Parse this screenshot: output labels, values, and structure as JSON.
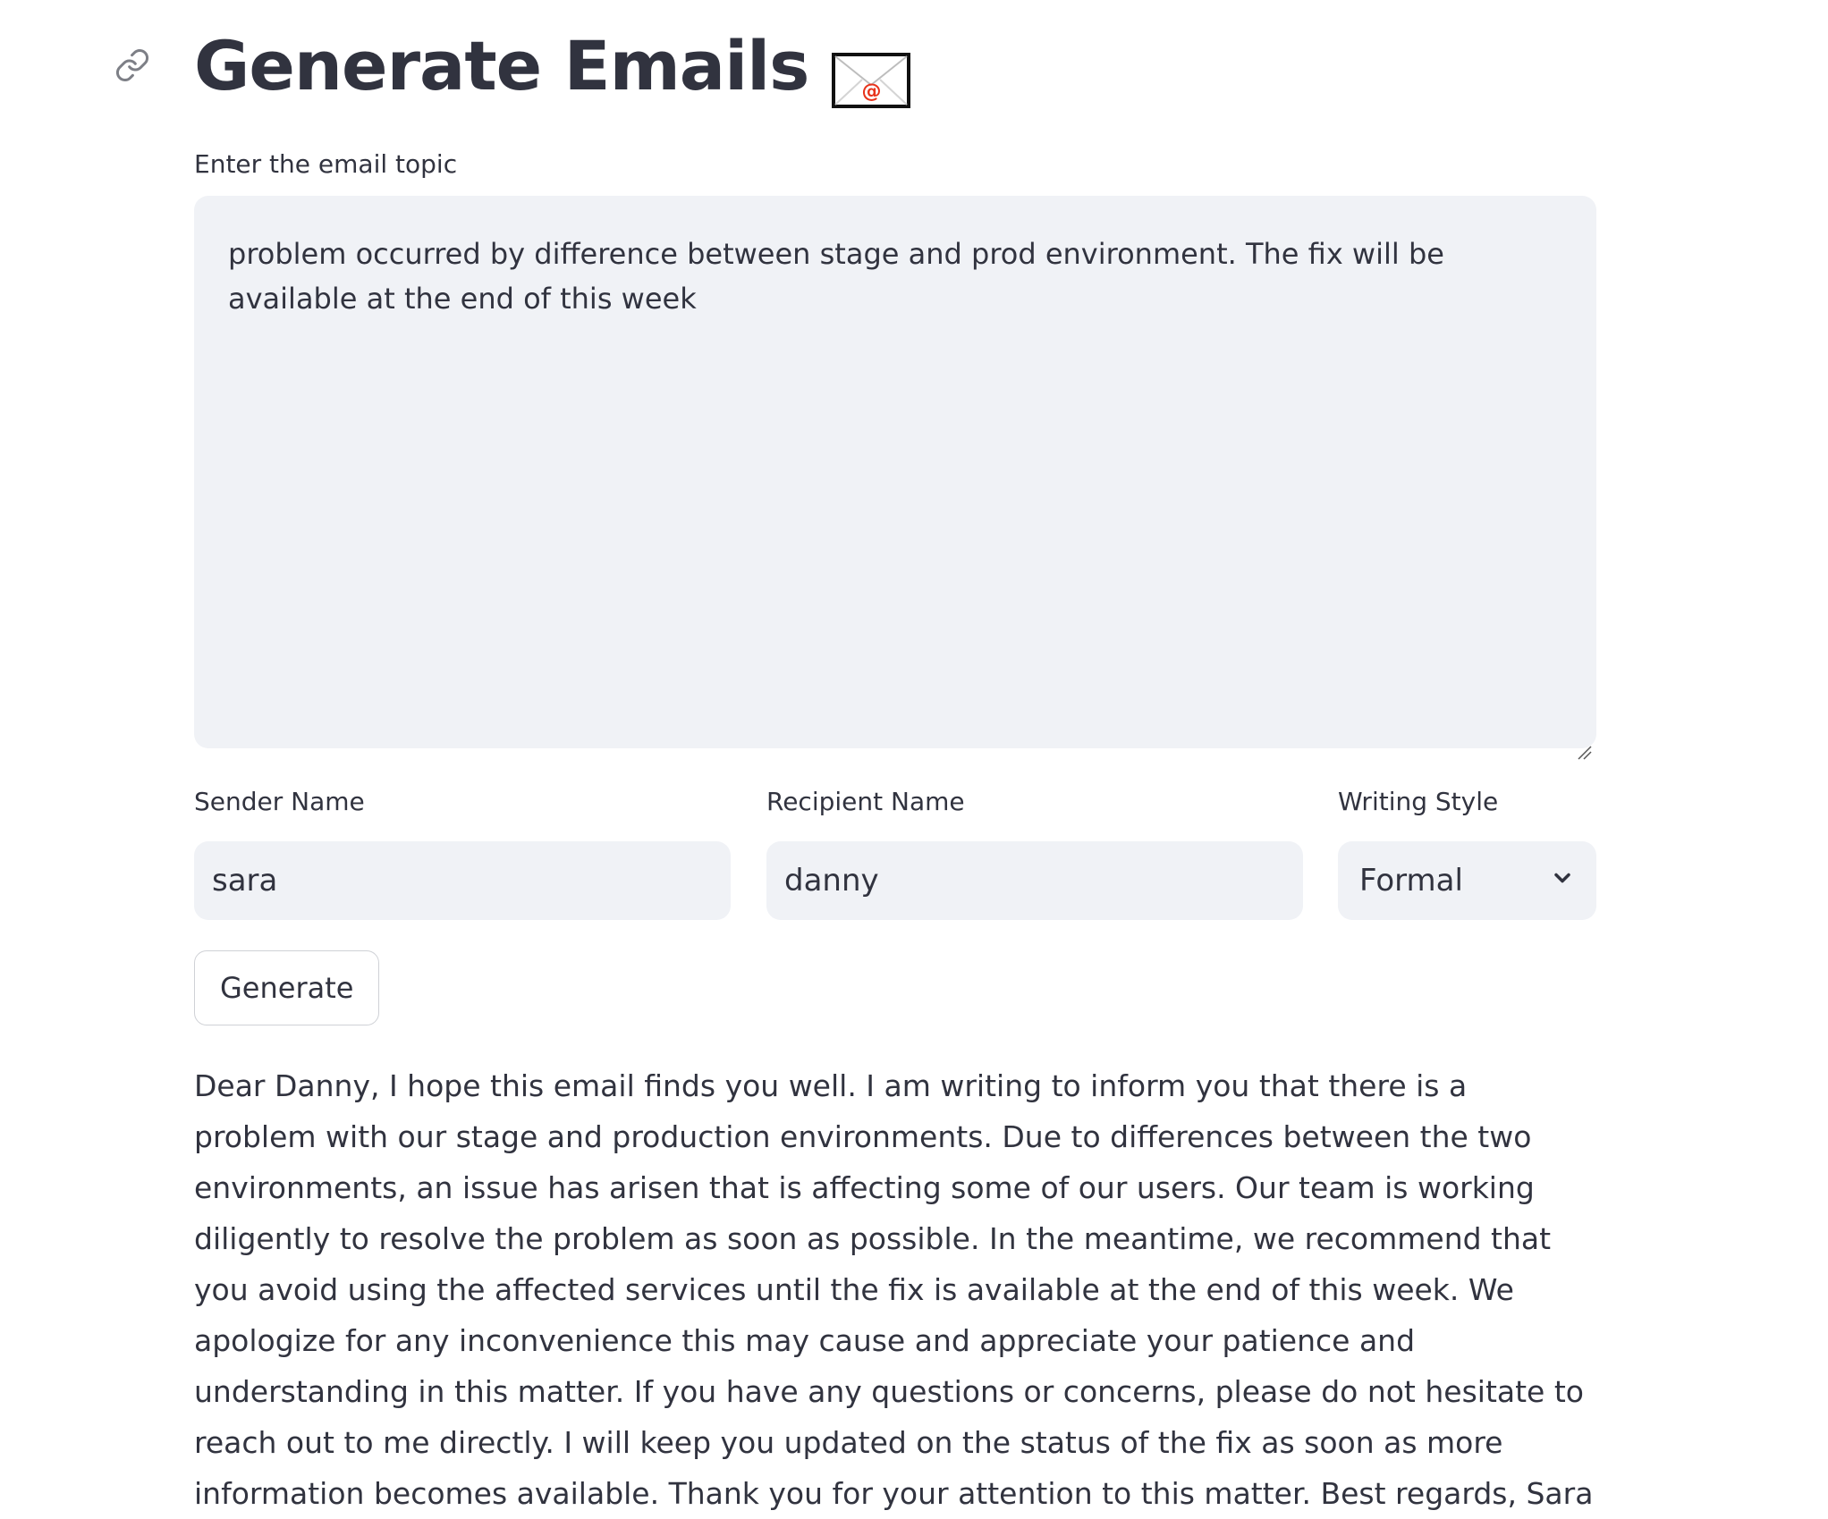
{
  "header": {
    "title": "Generate Emails",
    "title_emoji": "email-emoji",
    "link_icon": "link-icon"
  },
  "topic": {
    "label": "Enter the email topic",
    "value": "problem occurred by difference between stage and prod environment. The fix will be available at the end of this week"
  },
  "sender": {
    "label": "Sender Name",
    "value": "sara"
  },
  "recipient": {
    "label": "Recipient Name",
    "value": "danny"
  },
  "style": {
    "label": "Writing Style",
    "selected": "Formal"
  },
  "actions": {
    "generate_label": "Generate"
  },
  "output": {
    "email_text": "Dear Danny, I hope this email finds you well. I am writing to inform you that there is a problem with our stage and production environments. Due to differences between the two environments, an issue has arisen that is affecting some of our users. Our team is working diligently to resolve the problem as soon as possible. In the meantime, we recommend that you avoid using the affected services until the fix is available at the end of this week. We apologize for any inconvenience this may cause and appreciate your patience and understanding in this matter. If you have any questions or concerns, please do not hesitate to reach out to me directly. I will keep you updated on the status of the fix as soon as more information becomes available. Thank you for your attention to this matter. Best regards, Sara"
  },
  "colors": {
    "text": "#31333f",
    "input_bg": "#f0f2f6",
    "border": "#cfd1d6",
    "emoji_accent": "#e8341c"
  }
}
